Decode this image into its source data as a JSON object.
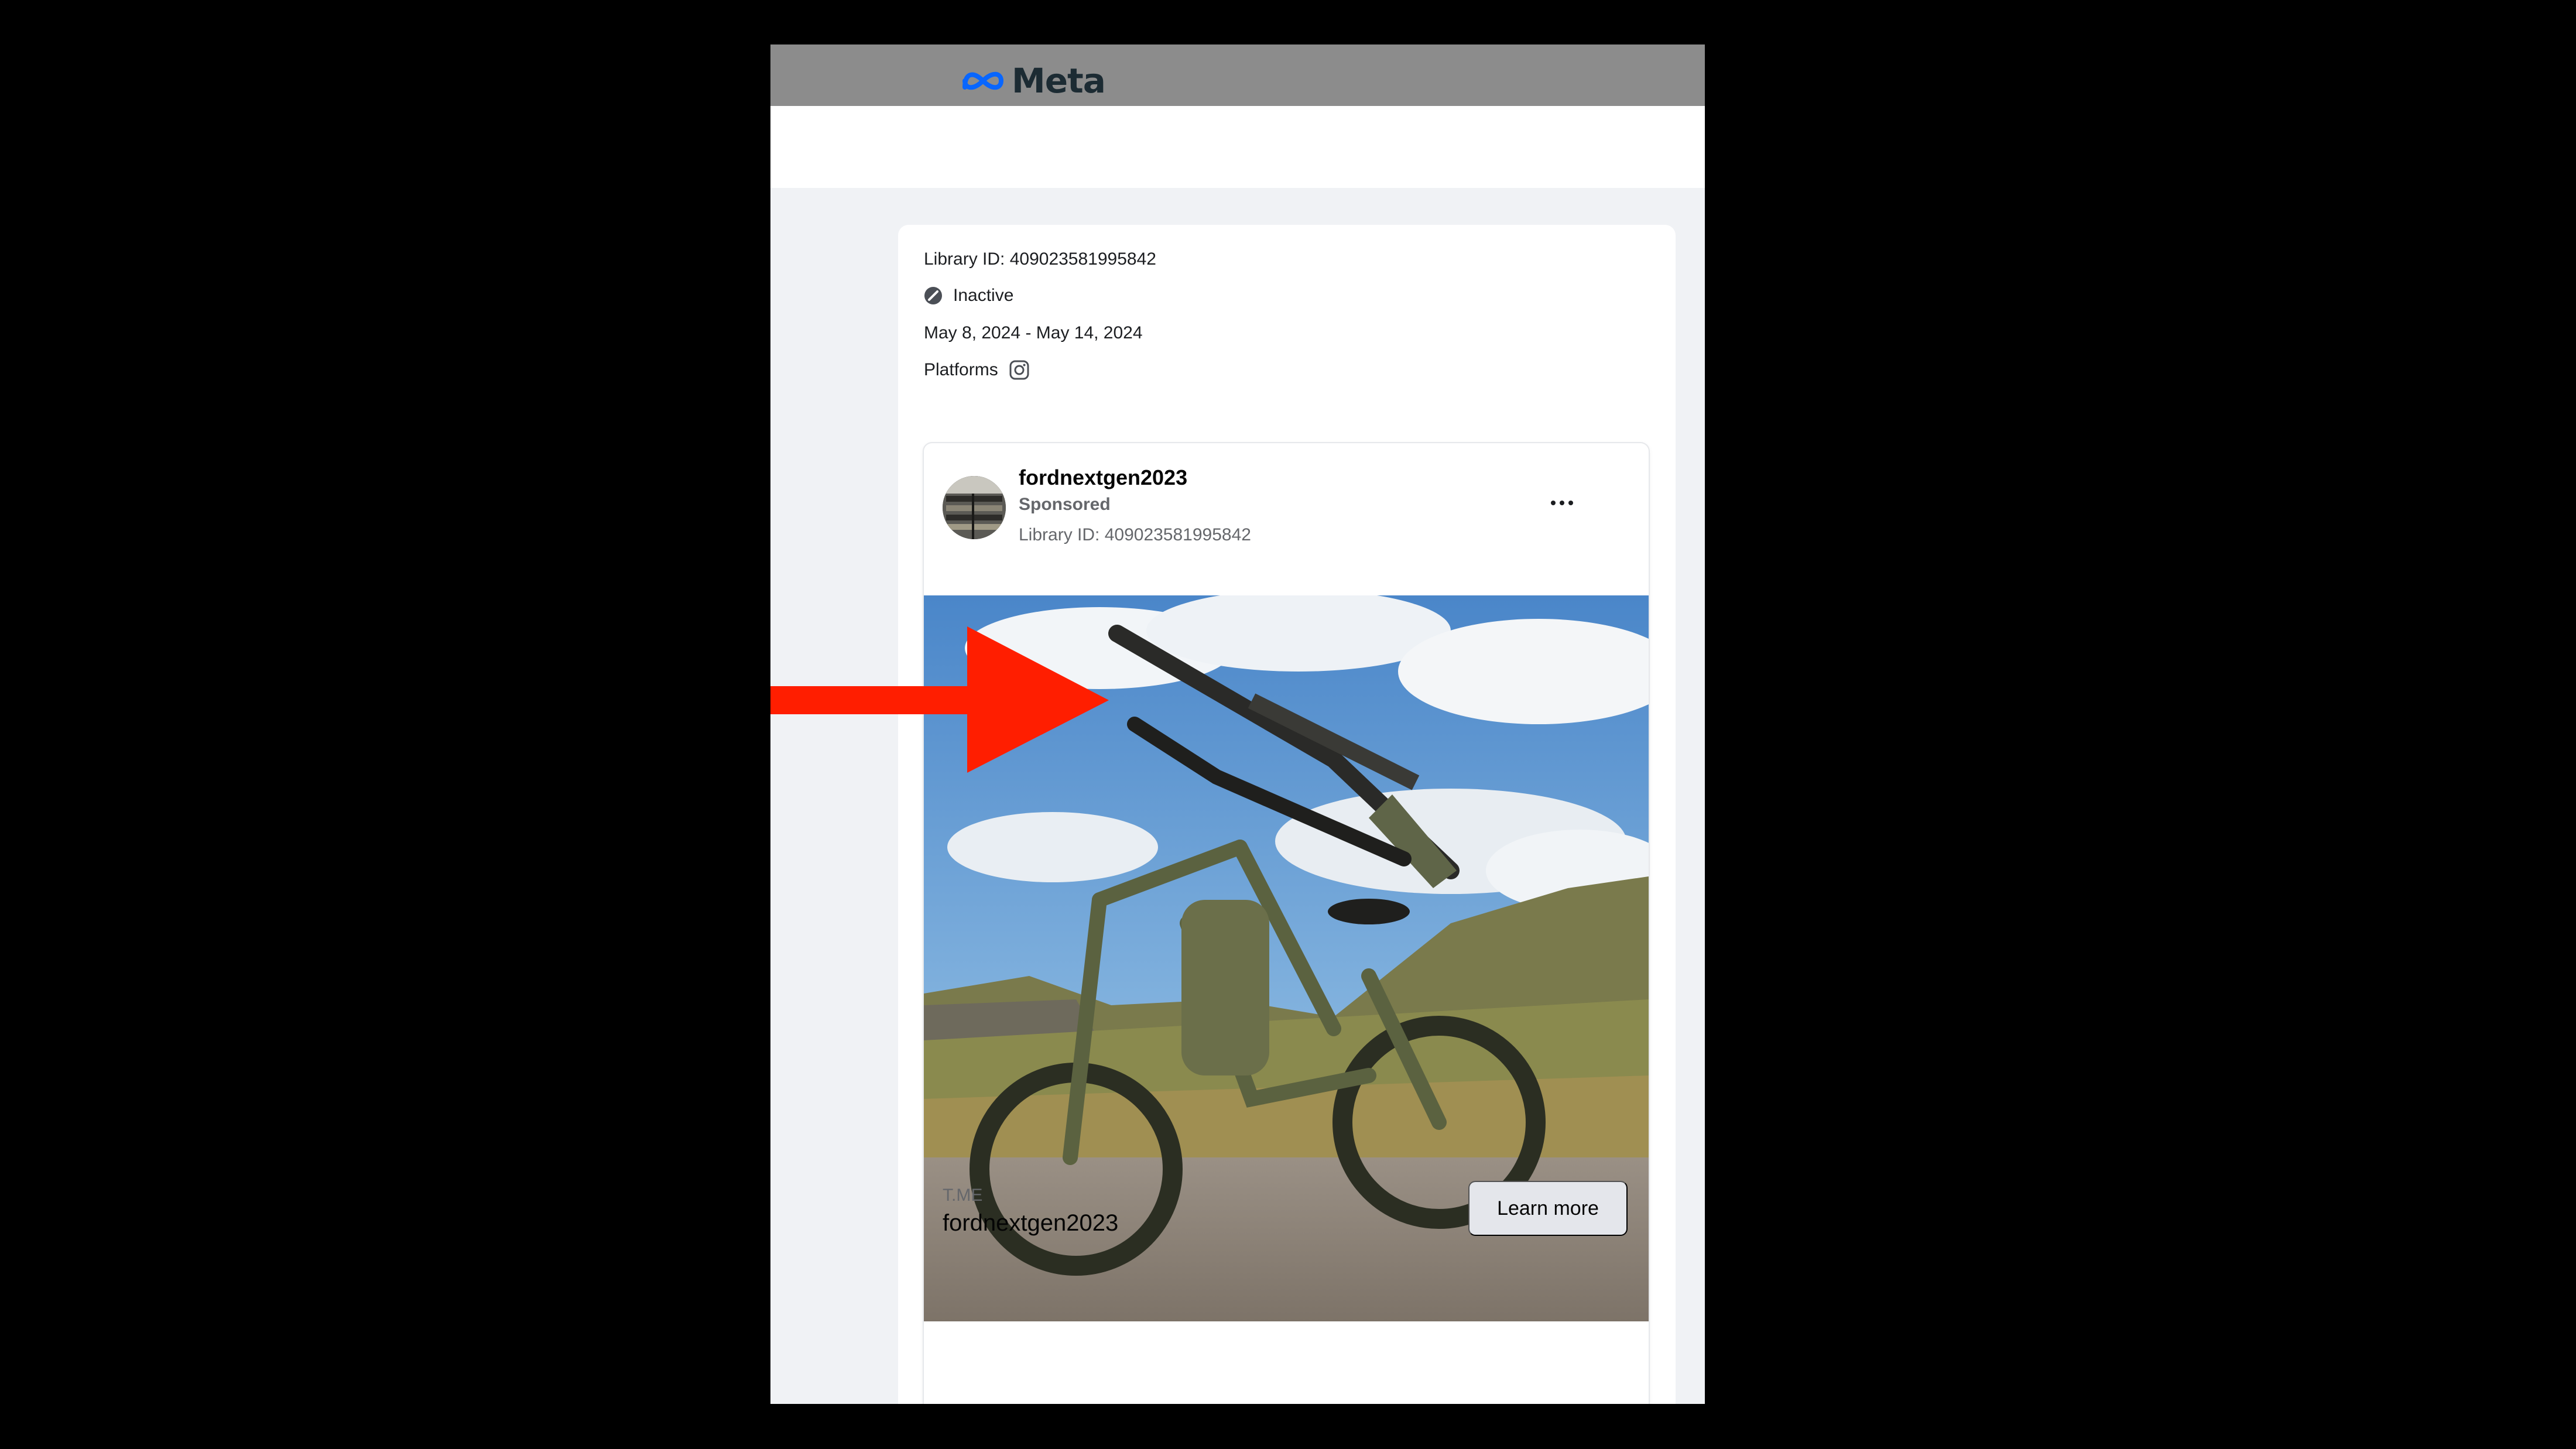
{
  "header": {
    "brand": "Meta"
  },
  "ad_details": {
    "library_id": "Library ID: 409023581995842",
    "status": "Inactive",
    "date_range": "May 8, 2024 - May 14, 2024",
    "platforms_label": "Platforms",
    "platform_icon": "instagram-icon"
  },
  "ad_card": {
    "page_name": "fordnextgen2023",
    "sponsored": "Sponsored",
    "library_id": "Library ID: 409023581995842",
    "more_icon": "more-dots-icon",
    "image_subject": "camouflage electric fat-tire bike with rifle mounted on handlebars, blue sky and hills",
    "link_domain": "T.ME",
    "link_headline": "fordnextgen2023",
    "cta_label": "Learn more"
  },
  "annotation": {
    "arrow_icon": "red-arrow-icon",
    "color": "#ff1e00"
  },
  "colors": {
    "background": "#000000",
    "page": "#f0f2f5",
    "topbar": "#8c8c8c",
    "cta": "#e4e6eb"
  }
}
